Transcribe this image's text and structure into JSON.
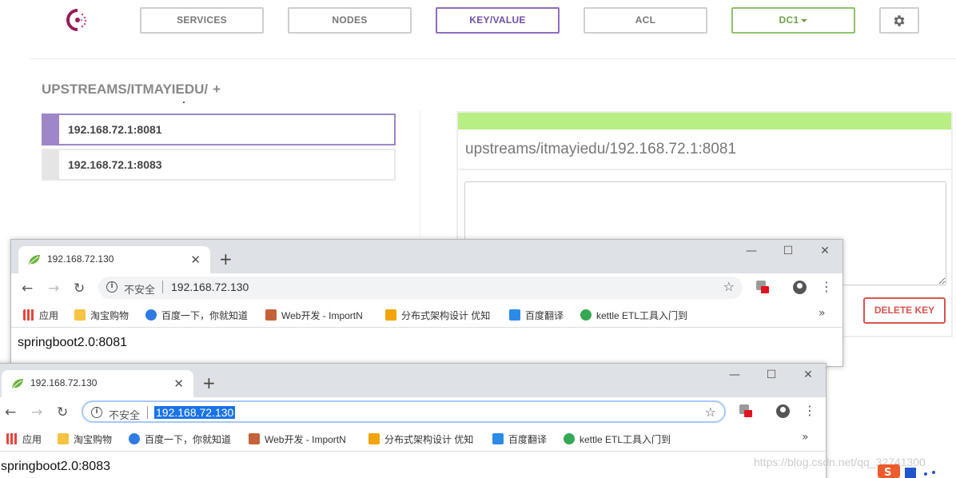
{
  "consul": {
    "nav": [
      {
        "label": "SERVICES"
      },
      {
        "label": "NODES"
      },
      {
        "label": "KEY/VALUE"
      },
      {
        "label": "ACL"
      },
      {
        "label": "DC1"
      }
    ],
    "breadcrumb": "UPSTREAMS/ITMAYIEDU/",
    "breadcrumb_add": "+",
    "keys": [
      {
        "label": "192.168.72.1:8081"
      },
      {
        "label": "192.168.72.1:8083"
      }
    ],
    "editor": {
      "key_path": "upstreams/itmayiedu/192.168.72.1:8081",
      "value": "",
      "delete_label": "DELETE KEY"
    }
  },
  "browsers": [
    {
      "tab_title": "192.168.72.130",
      "security_label": "不安全",
      "url": "192.168.72.130",
      "page_text": "springboot2.0:8081"
    },
    {
      "tab_title": "192.168.72.130",
      "security_label": "不安全",
      "url": "192.168.72.130",
      "page_text": "springboot2.0:8083"
    }
  ],
  "bookmarks": [
    {
      "label": "应用",
      "color": "#e8453c"
    },
    {
      "label": "淘宝购物",
      "color": "#f6c343"
    },
    {
      "label": "百度一下，你就知道",
      "color": "#2d7be5"
    },
    {
      "label": "Web开发 - ImportN",
      "color": "#c4633a"
    },
    {
      "label": "分布式架构设计 优知",
      "color": "#f2a40c"
    },
    {
      "label": "百度翻译",
      "color": "#2a8be8"
    },
    {
      "label": "kettle ETL工具入门到",
      "color": "#34a853"
    }
  ],
  "watermark": "https://blog.csdn.net/qq_32741300",
  "colors": {
    "accent_purple": "#8e6cbf",
    "dc_green": "#8fc26b",
    "saved_bar": "#b8ef84",
    "danger": "#d9534f"
  },
  "icons": [
    "consul-logo-icon",
    "gear-icon",
    "spring-leaf-icon",
    "back-arrow-icon",
    "forward-arrow-icon",
    "reload-icon",
    "info-icon",
    "star-icon",
    "avatar-icon",
    "kebab-menu-icon"
  ]
}
